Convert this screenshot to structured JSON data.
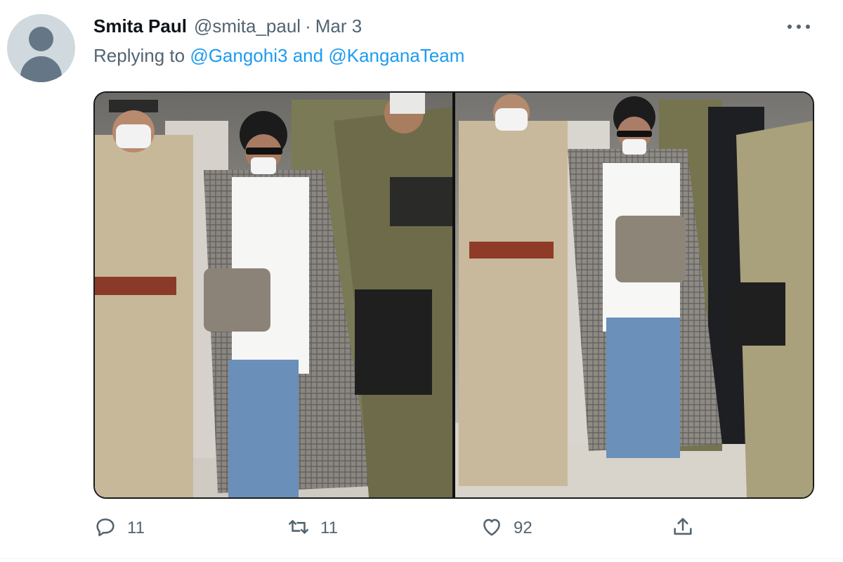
{
  "tweet": {
    "author_name": "Smita Paul",
    "author_handle": "@smita_paul",
    "separator": "·",
    "date": "Mar 3",
    "replying_prefix": "Replying to",
    "replying_user_1": "@Gangohi3",
    "replying_and": "and",
    "replying_user_2": "@KanganaTeam"
  },
  "actions": {
    "reply_count": "11",
    "retweet_count": "11",
    "like_count": "92"
  },
  "colors": {
    "link": "#1d9bf0",
    "secondary_text": "#536471",
    "primary_text": "#0f1419"
  },
  "icons": [
    "more-icon",
    "reply-icon",
    "retweet-icon",
    "like-icon",
    "share-icon"
  ]
}
